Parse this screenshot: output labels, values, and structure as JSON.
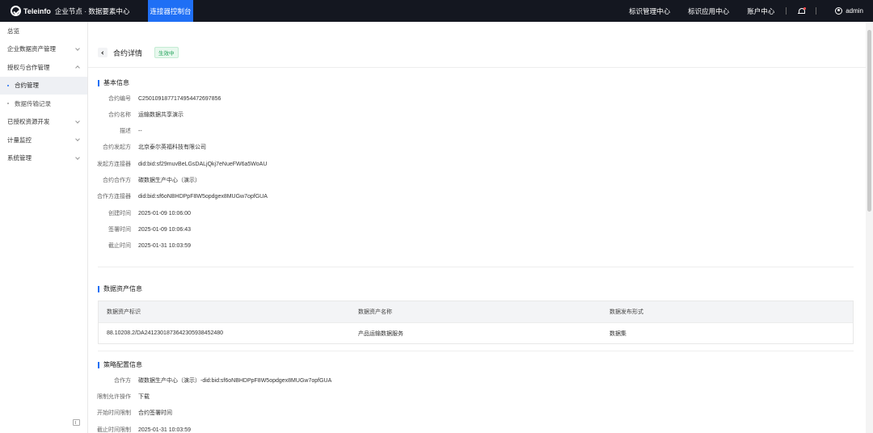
{
  "topbar": {
    "brand": "Teleinfo",
    "title": "企业节点 · 数据要素中心",
    "console_tab": "连接器控制台",
    "links": [
      "标识管理中心",
      "标识应用中心",
      "账户中心"
    ],
    "user": "admin"
  },
  "sidebar": {
    "items": [
      {
        "label": "总览"
      },
      {
        "label": "企业数据资产管理"
      },
      {
        "label": "授权与合作管理"
      },
      {
        "label": "合约管理"
      },
      {
        "label": "数据传输记录"
      },
      {
        "label": "已授权资源开发"
      },
      {
        "label": "计量监控"
      },
      {
        "label": "系统管理"
      }
    ]
  },
  "header": {
    "title": "合约详情",
    "status": "生效中"
  },
  "basic": {
    "title": "基本信息",
    "fields": [
      {
        "k": "合约编号",
        "v": "C250109187717495447269785​6"
      },
      {
        "k": "合约名称",
        "v": "运输数据共享演示"
      },
      {
        "k": "描述",
        "v": "--"
      },
      {
        "k": "合约发起方",
        "v": "北京泰尔英福科技有限公司"
      },
      {
        "k": "发起方连接器",
        "v": "did:bid:sf29muvBeLGsDALjQkj7eNueFW6a5WoAU"
      },
      {
        "k": "合约合作方",
        "v": "碳数据生产中心（演示）"
      },
      {
        "k": "合作方连接器",
        "v": "did:bid:sf6oNBHDPpF8W5opdgex8MUGw7opfGUA"
      },
      {
        "k": "创建时间",
        "v": "2025-01-09 10:06:00"
      },
      {
        "k": "签署时间",
        "v": "2025-01-09 10:06:43"
      },
      {
        "k": "截止时间",
        "v": "2025-01-31 10:03:59"
      }
    ]
  },
  "assets": {
    "title": "数据资产信息",
    "columns": [
      "数据资产标识",
      "数据资产名称",
      "数据发布形式"
    ],
    "rows": [
      [
        "88.10208.2/DA2412301873642305938452480",
        "产品运输数据服务",
        "数据集"
      ]
    ]
  },
  "policy": {
    "title": "策略配置信息",
    "fields": [
      {
        "k": "合作方",
        "v": "碳数据生产中心（演示）-did:bid:sf6oNBHDPpF8W5opdgex8MUGw7opfGUA"
      },
      {
        "k": "限制允许操作",
        "v": "下载"
      },
      {
        "k": "开始时间限制",
        "v": "合约签署时间"
      },
      {
        "k": "截止时间限制",
        "v": "2025-01-31 10:03:59"
      }
    ]
  }
}
